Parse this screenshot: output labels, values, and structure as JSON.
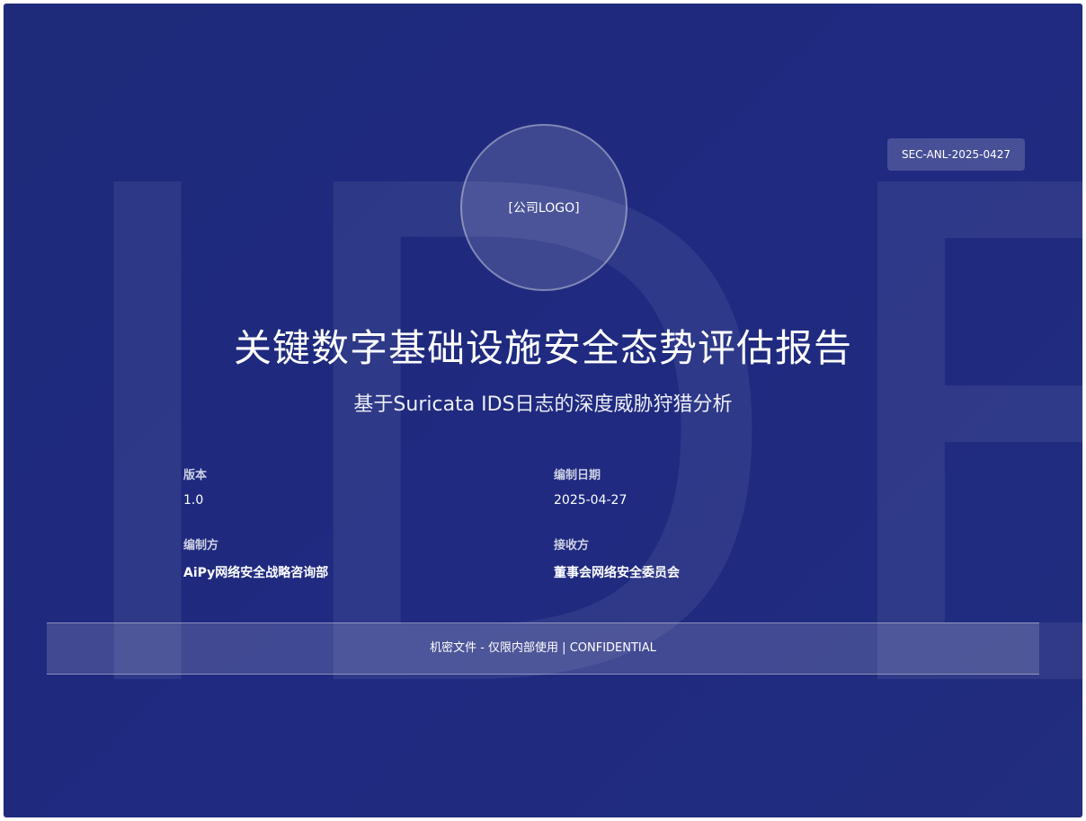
{
  "cover": {
    "watermark_text": "IDE",
    "document_code": "SEC-ANL-2025-0427",
    "logo_text": "[公司LOGO]",
    "title": "关键数字基础设施安全态势评估报告",
    "subtitle": "基于Suricata IDS日志的深度威胁狩猎分析",
    "meta": {
      "version_label": "版本",
      "version_value": "1.0",
      "date_label": "编制日期",
      "date_value": "2025-04-27",
      "author_label": "编制方",
      "author_value": "AiPy网络安全战略咨询部",
      "recipient_label": "接收方",
      "recipient_value": "董事会网络安全委员会"
    },
    "footer_banner": "机密文件 - 仅限内部使用 | CONFIDENTIAL"
  }
}
